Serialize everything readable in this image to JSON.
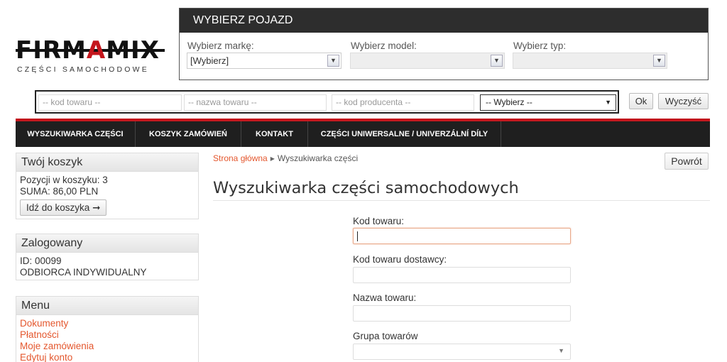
{
  "logo": {
    "part1": "FIRM",
    "part2": "A",
    "part3": "MIX",
    "subtitle": "CZĘŚCI SAMOCHODOWE"
  },
  "vehicle": {
    "title": "WYBIERZ POJAZD",
    "brand_label": "Wybierz markę:",
    "brand_value": "[Wybierz]",
    "model_label": "Wybierz model:",
    "model_value": "",
    "type_label": "Wybierz typ:",
    "type_value": ""
  },
  "search": {
    "code_placeholder": "-- kod towaru --",
    "name_placeholder": "-- nazwa towaru --",
    "producer_placeholder": "-- kod producenta --",
    "select_value": "-- Wybierz --",
    "ok_label": "Ok",
    "clear_label": "Wyczyść"
  },
  "nav": {
    "items": [
      {
        "label": "WYSZUKIWARKA CZĘŚCI"
      },
      {
        "label": "KOSZYK ZAMÓWIEŃ"
      },
      {
        "label": "KONTAKT"
      },
      {
        "label": "CZĘŚCI UNIWERSALNE / UNIVERZÁLNÍ DÍLY"
      }
    ]
  },
  "cart": {
    "title": "Twój koszyk",
    "items_line": "Pozycji w koszyku: 3",
    "sum_line": "SUMA: 86,00 PLN",
    "button_label": "Idź do koszyka",
    "button_arrow": "➞"
  },
  "user": {
    "title": "Zalogowany",
    "id_line": "ID: 00099",
    "type_line": "ODBIORCA INDYWIDUALNY"
  },
  "menu": {
    "title": "Menu",
    "items": [
      {
        "label": "Dokumenty"
      },
      {
        "label": "Płatności"
      },
      {
        "label": "Moje zamówienia"
      },
      {
        "label": "Edytuj konto"
      }
    ]
  },
  "breadcrumb": {
    "home": "Strona główna",
    "current": "Wyszukiwarka części"
  },
  "main": {
    "back_label": "Powrót",
    "title": "Wyszukiwarka części samochodowych",
    "fields": {
      "code_label": "Kod towaru:",
      "supplier_code_label": "Kod towaru dostawcy:",
      "name_label": "Nazwa towaru:",
      "group_label": "Grupa towarów",
      "group_value": ""
    }
  },
  "colors": {
    "accent": "#c4161c",
    "link": "#e4572e",
    "nav_bg": "#1f1f1f"
  },
  "icons": {
    "dropdown": "chevron-down-icon",
    "caret": "caret-icon"
  }
}
